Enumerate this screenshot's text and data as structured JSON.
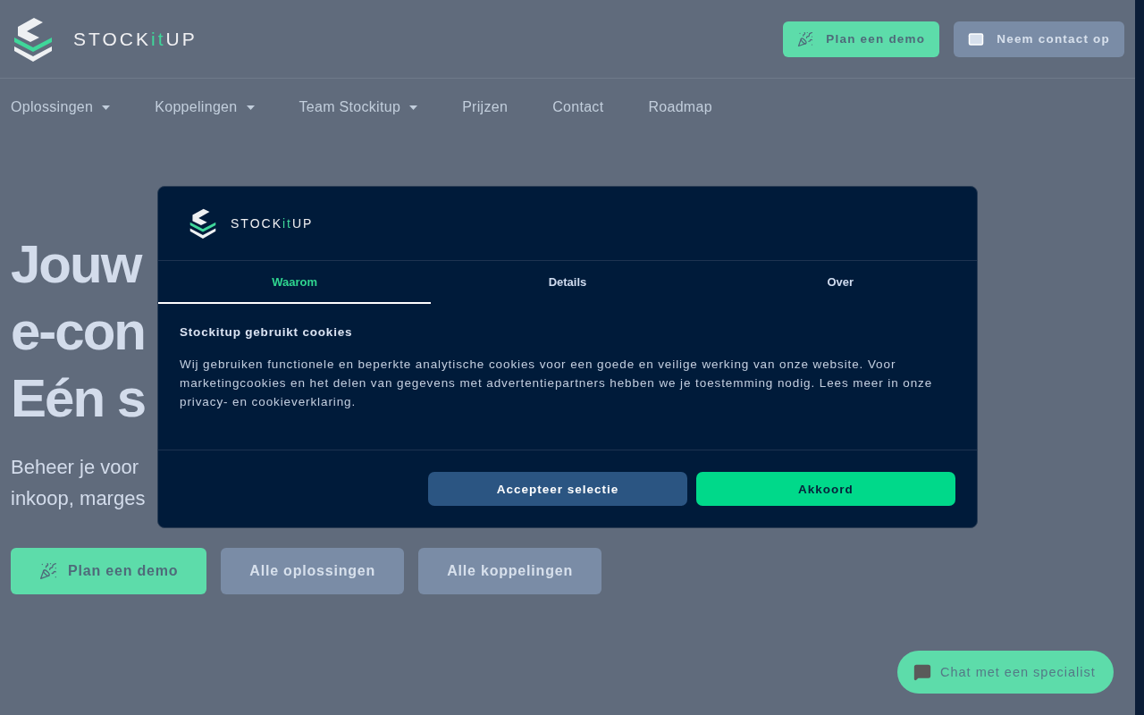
{
  "header": {
    "logo": [
      {
        "text": "STOCK",
        "kind": "plain"
      },
      {
        "text": "it",
        "kind": "accent"
      },
      {
        "text": "UP",
        "kind": "plain"
      }
    ],
    "buttons": [
      {
        "label": "Plan een demo",
        "kind": "primary"
      },
      {
        "label": "Neem contact op",
        "kind": "secondary"
      }
    ]
  },
  "nav": [
    {
      "label": "Oplossingen",
      "dropdown": true
    },
    {
      "label": "Koppelingen",
      "dropdown": true
    },
    {
      "label": "Team Stockitup",
      "dropdown": true
    },
    {
      "label": "Prijzen",
      "dropdown": false
    },
    {
      "label": "Contact",
      "dropdown": false
    },
    {
      "label": "Roadmap",
      "dropdown": false
    }
  ],
  "hero": {
    "title_lines": [
      "Jouw",
      "e-con",
      "Eén s"
    ],
    "subtitle_lines": [
      "Beheer je voor",
      "inkoop, marges"
    ],
    "buttons": [
      {
        "label": "Plan een demo",
        "kind": "primary"
      },
      {
        "label": "Alle oplossingen",
        "kind": "secondary"
      },
      {
        "label": "Alle koppelingen",
        "kind": "secondary"
      }
    ]
  },
  "cookie_dialog": {
    "logo": [
      {
        "text": "STOCK",
        "kind": "plain"
      },
      {
        "text": "it",
        "kind": "accent"
      },
      {
        "text": "UP",
        "kind": "plain"
      }
    ],
    "tabs": [
      {
        "label": "Waarom",
        "selected": true
      },
      {
        "label": "Details",
        "selected": false
      },
      {
        "label": "Over",
        "selected": false
      }
    ],
    "heading": "Stockitup gebruikt cookies",
    "text": "Wij gebruiken functionele en beperkte analytische cookies voor een goede en veilige werking van onze website. Voor marketingcookies en het delen van gegevens met advertentiepartners hebben we je toestemming nodig. Lees meer in onze privacy- en cookieverklaring.",
    "buttons": [
      {
        "label": "Accepteer selectie",
        "kind": "secondary"
      },
      {
        "label": "Akkoord",
        "kind": "primary"
      }
    ]
  },
  "chat_button": {
    "label": "Chat met een specialist"
  }
}
